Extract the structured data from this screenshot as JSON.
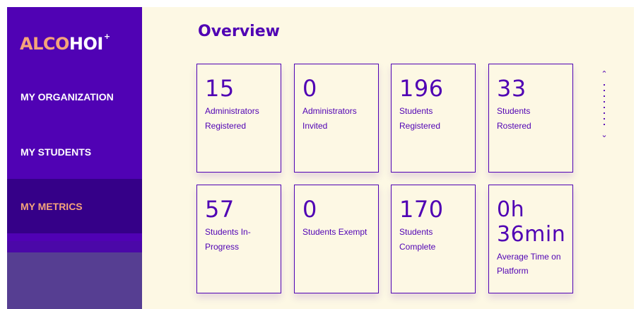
{
  "brand": {
    "logo_main": "ALCO",
    "logo_num": "HOI",
    "logo_sup": "+"
  },
  "sidebar": {
    "items": [
      {
        "label": "MY ORGANIZATION",
        "active": false
      },
      {
        "label": "MY STUDENTS",
        "active": false
      },
      {
        "label": "MY METRICS",
        "active": true
      }
    ]
  },
  "main": {
    "title": "Overview",
    "cards": [
      {
        "value": "15",
        "label": "Administrators Registered"
      },
      {
        "value": "0",
        "label": "Administrators Invited"
      },
      {
        "value": "196",
        "label": "Students Registered"
      },
      {
        "value": "33",
        "label": "Students Rostered"
      },
      {
        "value": "57",
        "label": "Students In-Progress"
      },
      {
        "value": "0",
        "label": "Students Exempt"
      },
      {
        "value": "170",
        "label": "Students Complete"
      },
      {
        "value": "0h 36min",
        "label": "Average Time on Platform"
      }
    ]
  },
  "scroll": {
    "up_icon": "chevron-up-icon",
    "down_icon": "chevron-down-icon"
  },
  "colors": {
    "brand_purple": "#5002b4",
    "active_nav": "#350088",
    "accent_orange": "#f5a47a",
    "background_cream": "#fdf8e4"
  }
}
